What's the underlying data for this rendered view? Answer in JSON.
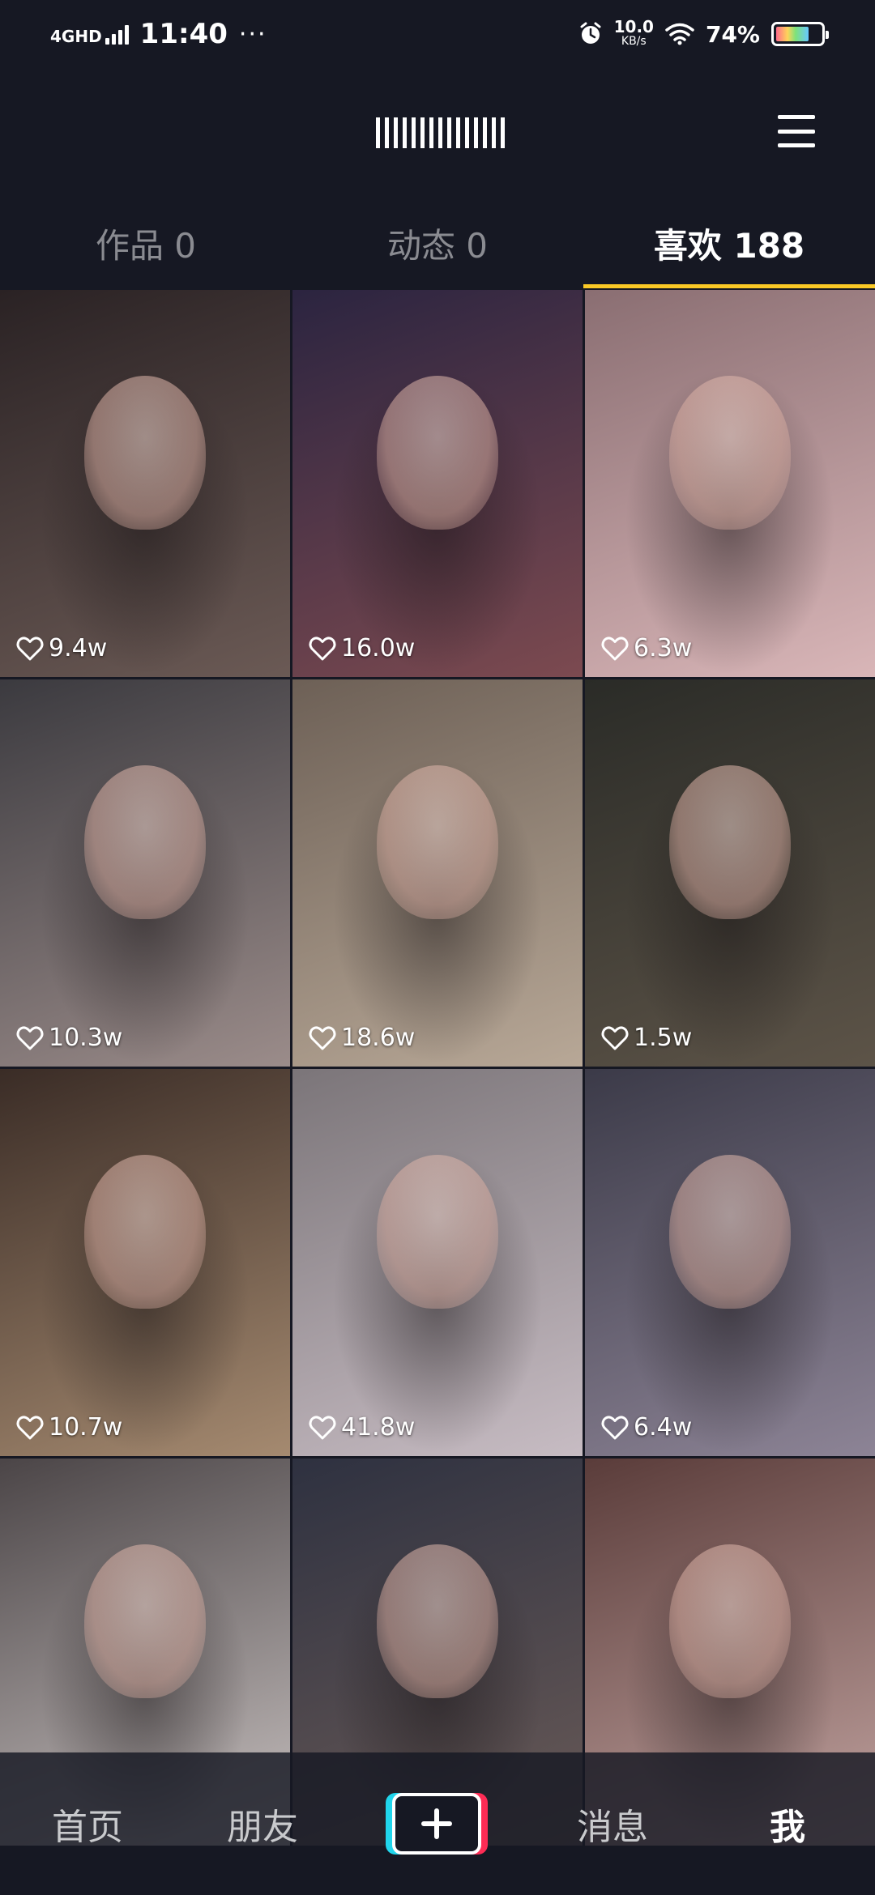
{
  "status_bar": {
    "network": "4GHD",
    "time": "11:40",
    "more": "···",
    "speed_value": "10.0",
    "speed_unit": "KB/s",
    "battery_percent": "74%",
    "battery_level": 0.74,
    "icons": [
      "signal-icon",
      "alarm-icon",
      "wifi-icon",
      "battery-icon"
    ]
  },
  "header": {
    "menu_icon": "hamburger-menu-icon"
  },
  "tabs": [
    {
      "label": "作品 0",
      "active": false
    },
    {
      "label": "动态 0",
      "active": false
    },
    {
      "label": "喜欢 188",
      "active": true
    }
  ],
  "grid": {
    "items": [
      {
        "likes": "9.4w",
        "tone": [
          "#2a2224",
          "#6b5a55"
        ]
      },
      {
        "likes": "16.0w",
        "tone": [
          "#2b2440",
          "#7c4a50"
        ]
      },
      {
        "likes": "6.3w",
        "tone": [
          "#8a6e72",
          "#d9b6b8"
        ]
      },
      {
        "likes": "10.3w",
        "tone": [
          "#3b3a3f",
          "#9b8c8a"
        ]
      },
      {
        "likes": "18.6w",
        "tone": [
          "#6d6056",
          "#b8a897"
        ]
      },
      {
        "likes": "1.5w",
        "tone": [
          "#2a2b27",
          "#5d5448"
        ]
      },
      {
        "likes": "10.7w",
        "tone": [
          "#3a2c26",
          "#a58a70"
        ]
      },
      {
        "likes": "41.8w",
        "tone": [
          "#7b7579",
          "#c7bcc3"
        ]
      },
      {
        "likes": "6.4w",
        "tone": [
          "#3b3a48",
          "#8d8496"
        ]
      },
      {
        "likes": "",
        "tone": [
          "#4b4547",
          "#c8c1c0"
        ]
      },
      {
        "likes": "",
        "tone": [
          "#2e3140",
          "#6a5b58"
        ]
      },
      {
        "likes": "",
        "tone": [
          "#5a3c3a",
          "#c2a3a0"
        ]
      }
    ],
    "heart_icon": "heart-outline-icon"
  },
  "bottom_nav": {
    "home": "首页",
    "friends": "朋友",
    "create_icon": "plus-icon",
    "messages": "消息",
    "me": "我"
  }
}
